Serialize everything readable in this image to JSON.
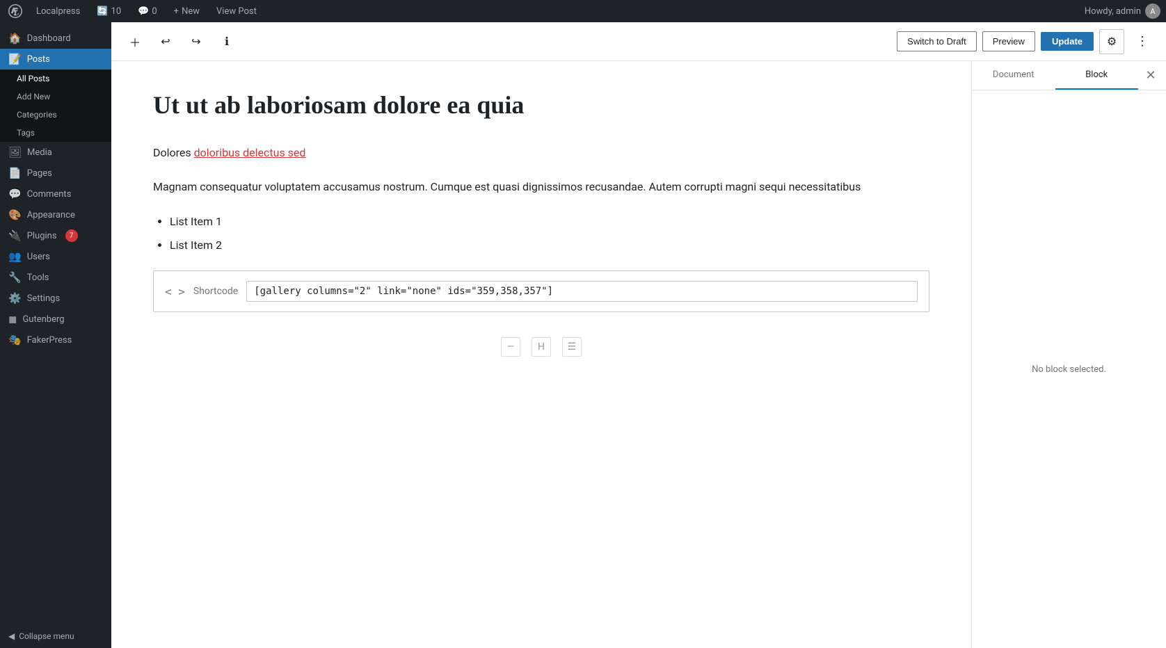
{
  "adminbar": {
    "logo": "⊕",
    "site_name": "Localpress",
    "updates_count": "10",
    "comments_count": "0",
    "new_label": "New",
    "view_post_label": "View Post",
    "howdy": "Howdy, admin"
  },
  "sidebar": {
    "dashboard_label": "Dashboard",
    "posts_label": "Posts",
    "all_posts_label": "All Posts",
    "add_new_label": "Add New",
    "categories_label": "Categories",
    "tags_label": "Tags",
    "media_label": "Media",
    "pages_label": "Pages",
    "comments_label": "Comments",
    "appearance_label": "Appearance",
    "plugins_label": "Plugins",
    "plugins_badge": "7",
    "users_label": "Users",
    "tools_label": "Tools",
    "settings_label": "Settings",
    "gutenberg_label": "Gutenberg",
    "fakerpress_label": "FakerPress",
    "collapse_label": "Collapse menu"
  },
  "toolbar": {
    "switch_to_draft_label": "Switch to Draft",
    "preview_label": "Preview",
    "update_label": "Update"
  },
  "panel": {
    "document_tab": "Document",
    "block_tab": "Block",
    "no_block_selected": "No block selected."
  },
  "post": {
    "title": "Ut ut ab laboriosam dolore ea quia",
    "paragraph1_start": "Dolores ",
    "paragraph1_link": "doloribus delectus sed",
    "paragraph2": "Magnam consequatur voluptatem accusamus nostrum. Cumque est quasi dignissimos recusandae. Autem corrupti magni sequi necessitatibus",
    "list_items": [
      "List Item 1",
      "List Item 2"
    ],
    "shortcode_label": "Shortcode",
    "shortcode_value": "[gallery columns=\"2\" link=\"none\" ids=\"359,358,357\"]"
  }
}
